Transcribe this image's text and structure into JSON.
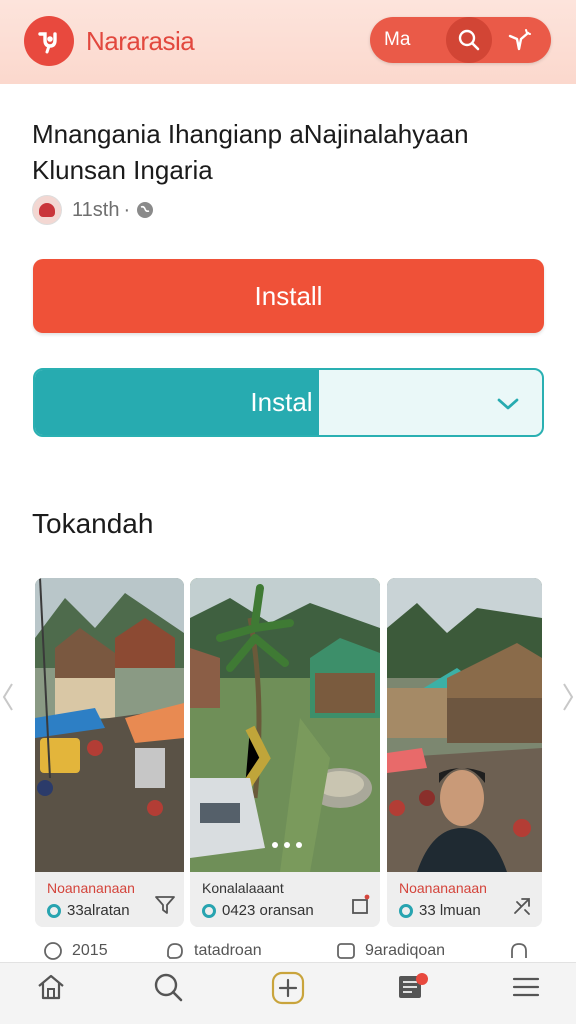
{
  "app": {
    "title": "Nararasia",
    "header_label": "Ma",
    "icons": {
      "logo": "app-logo",
      "search": "search-icon",
      "star": "sparkle-icon"
    }
  },
  "post": {
    "title": "Mnangania Ihangianp aNajinalahyaan Klunsan Ingaria",
    "time": "11sth",
    "separator": "·",
    "visibility_icon": "globe-icon"
  },
  "actions": {
    "install_primary": "Install",
    "install_secondary": "Instal",
    "install_progress": 0.56
  },
  "section": {
    "title": "Tokandah"
  },
  "cards": [
    {
      "category": "Noanananaan",
      "stat": "33alratan",
      "action_icon": "filter-icon"
    },
    {
      "category": "Konalalaaant",
      "stat": "0423 oransan",
      "action_icon": "share-icon"
    },
    {
      "category": "Noanananaan",
      "stat": "33 lmuan",
      "action_icon": "sparkle-icon"
    }
  ],
  "reactions": [
    {
      "icon": "heart-icon",
      "label": "2015"
    },
    {
      "icon": "comment-icon",
      "label": "tatadroan"
    },
    {
      "icon": "bookmark-icon",
      "label": "9aradiqoan"
    },
    {
      "icon": "bell-icon",
      "label": ""
    }
  ],
  "nav": [
    {
      "icon": "home-icon",
      "label": ""
    },
    {
      "icon": "search-icon",
      "label": ""
    },
    {
      "icon": "add-icon",
      "label": ""
    },
    {
      "icon": "notebook-icon",
      "label": "",
      "badge": true
    },
    {
      "icon": "menu-icon",
      "label": ""
    }
  ],
  "colors": {
    "brand": "#e8493e",
    "install_primary": "#ef5138",
    "install_secondary": "#27abb0",
    "header_bg": "#fbd8cd"
  }
}
